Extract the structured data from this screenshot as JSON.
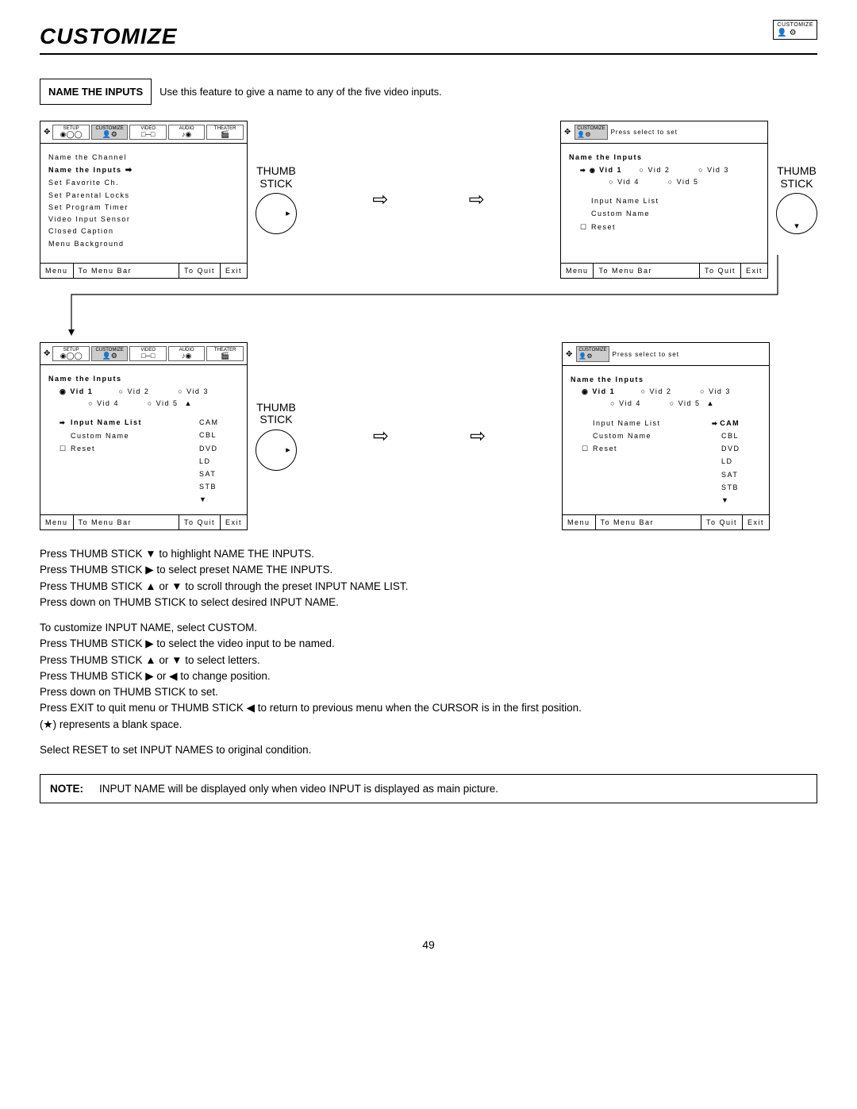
{
  "page": {
    "title": "CUSTOMIZE",
    "topIconLabel": "CUSTOMIZE",
    "number": "49"
  },
  "feature": {
    "label": "NAME THE INPUTS",
    "desc": "Use this feature to give a name to any of the five video inputs."
  },
  "thumbStickLabel": "THUMB STICK",
  "headerTabs": {
    "setup": "SETUP",
    "customize": "CUSTOMIZE",
    "video": "VIDEO",
    "audio": "AUDIO",
    "theater": "THEATER"
  },
  "footer": {
    "menu": "Menu",
    "toMenuBar": "To Menu Bar",
    "toQuit": "To Quit",
    "exit": "Exit"
  },
  "screen1": {
    "items": {
      "nameChannel": "Name the Channel",
      "nameInputs": "Name the Inputs",
      "setFavorite": "Set Favorite Ch.",
      "setParental": "Set Parental Locks",
      "setTimer": "Set Program Timer",
      "videoSensor": "Video Input Sensor",
      "closedCaption": "Closed Caption",
      "menuBg": "Menu Background"
    }
  },
  "screen2": {
    "hint": "Press select to set",
    "title": "Name the Inputs",
    "vid1": "Vid 1",
    "vid2": "Vid 2",
    "vid3": "Vid 3",
    "vid4": "Vid 4",
    "vid5": "Vid 5",
    "optInputNameList": "Input Name List",
    "optCustomName": "Custom Name",
    "optReset": "Reset"
  },
  "nameList": {
    "cam": "CAM",
    "cbl": "CBL",
    "dvd": "DVD",
    "ld": "LD",
    "sat": "SAT",
    "stb": "STB"
  },
  "instructions": {
    "line1": "Press THUMB STICK ▼ to highlight NAME THE INPUTS.",
    "line2": "Press THUMB STICK ▶ to select preset NAME THE INPUTS.",
    "line3": "Press THUMB STICK ▲ or ▼ to scroll through the preset INPUT NAME LIST.",
    "line4": "Press down on THUMB STICK to select desired INPUT NAME.",
    "line5": "To customize INPUT NAME, select CUSTOM.",
    "line6": "Press THUMB STICK ▶ to select the video input to be named.",
    "line7": "Press THUMB STICK ▲ or ▼ to select letters.",
    "line8": "Press THUMB STICK ▶ or ◀ to change position.",
    "line9": "Press down on THUMB STICK to set.",
    "line10": "Press EXIT to quit menu or THUMB STICK ◀ to return to previous menu when the CURSOR is in the first position.",
    "line11": "(★) represents a blank space.",
    "line12": "Select RESET to set INPUT NAMES to original condition."
  },
  "note": {
    "label": "NOTE:",
    "text": "INPUT NAME will be displayed only when video INPUT is displayed as main picture."
  }
}
